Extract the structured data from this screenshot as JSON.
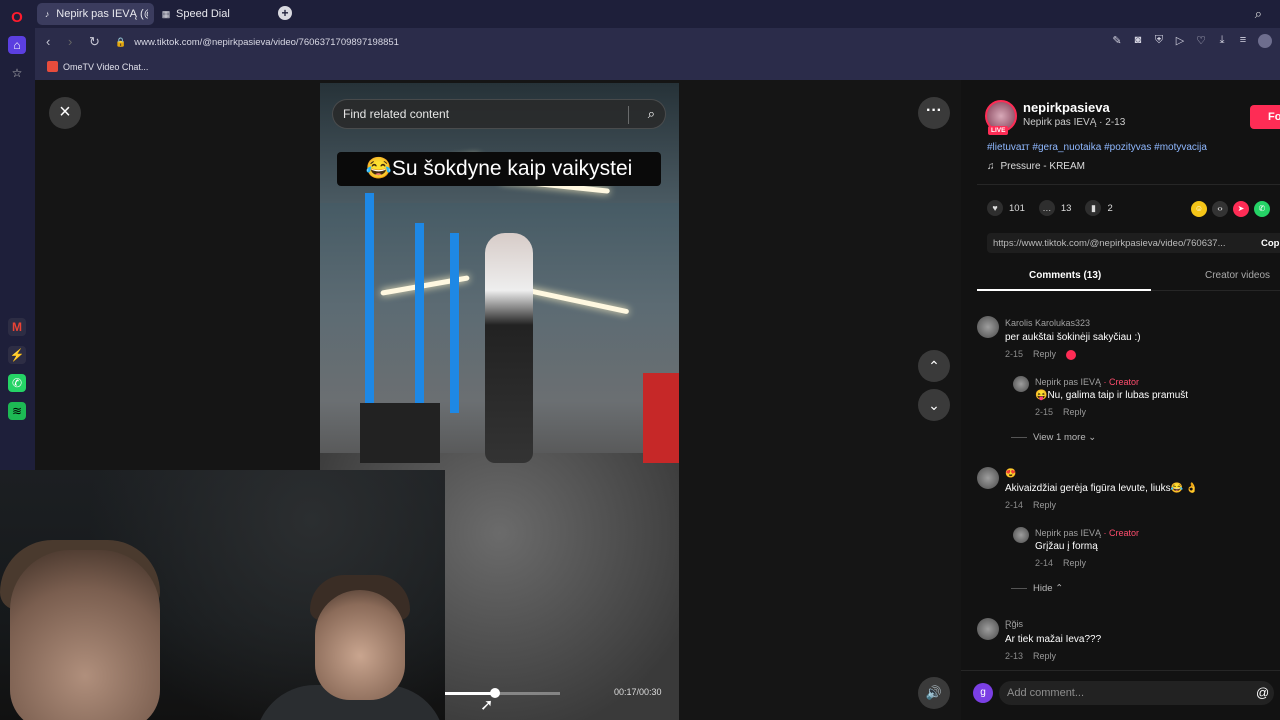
{
  "browser": {
    "tabs": [
      {
        "label": "Nepirk pas IEVĄ (@ne",
        "icon": "tiktok-icon"
      },
      {
        "label": "Speed Dial",
        "icon": "grid-icon"
      }
    ],
    "url": "www.tiktok.com/@nepirkpasieva/video/7606371709897198851",
    "bookmarks": [
      {
        "label": "OmeTV Video Chat..."
      }
    ]
  },
  "video": {
    "search_placeholder": "Find related content",
    "caption": "😂Su šokdyne kaip vaikystei",
    "time": "00:17/00:30",
    "progress_fraction": 0.567
  },
  "panel": {
    "author_name": "nepirkpasieva",
    "author_sub": "Nepirk pas IEVĄ · 2-13",
    "live_badge": "LIVE",
    "follow_label": "Fo",
    "hashtags": "#lietuvaɪᴛ #gera_nuotaika #pozityvas #motyvacija",
    "music": "Pressure - KREAM",
    "likes": "101",
    "comments_count": "13",
    "saves": "2",
    "link": "https://www.tiktok.com/@nepirkpasieva/video/760637...",
    "copy_label": "Cop",
    "tab_comments": "Comments (13)",
    "tab_creator": "Creator videos",
    "comments": [
      {
        "user": "Karolis Karolukas323",
        "text": "per aukštai šokinėji sakyčiau :)",
        "date": "2-15",
        "reply": "Reply"
      },
      {
        "user": "Nepirk pas IEVĄ",
        "creator": "· Creator",
        "text": "😝Nu, galima taip ir lubas pramušt",
        "date": "2-15",
        "reply": "Reply"
      },
      {
        "more": "View 1 more"
      },
      {
        "user": "😍",
        "text": "Akivaizdžiai gerėja figūra levute, liuks😂 👌",
        "date": "2-14",
        "reply": "Reply"
      },
      {
        "user": "Nepirk pas IEVĄ",
        "creator": "· Creator",
        "text": "Grįžau į formą",
        "date": "2-14",
        "reply": "Reply"
      },
      {
        "hide": "Hide"
      },
      {
        "user": "Ɽğɨs",
        "text": "Ar tiek mažai Ieva???",
        "date": "2-13",
        "reply": "Reply"
      }
    ],
    "add_comment": "Add comment...",
    "user_initial": "g"
  }
}
